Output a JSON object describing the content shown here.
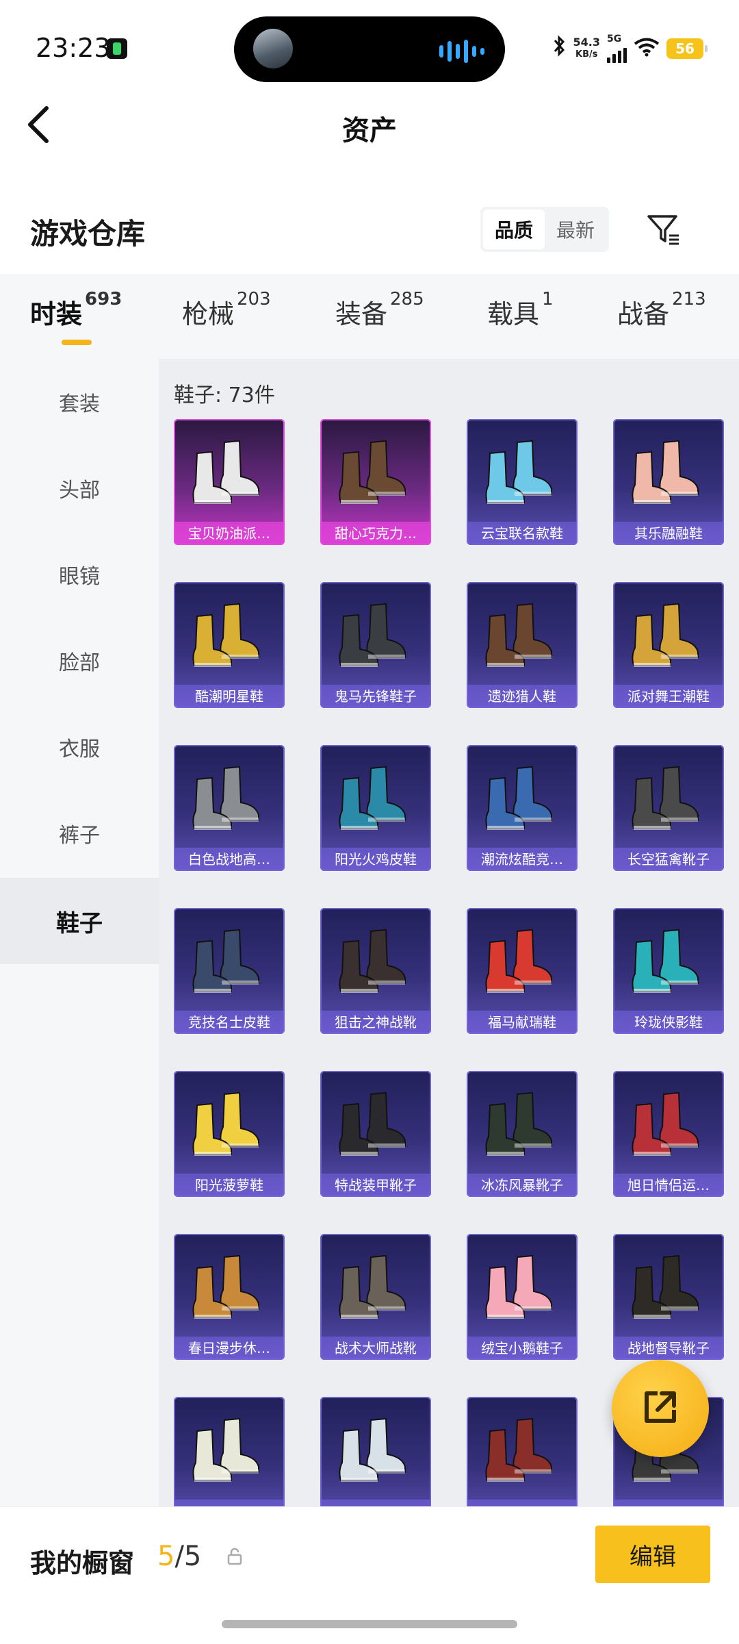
{
  "status_bar": {
    "time": "23:23",
    "net_speed_value": "54.3",
    "net_speed_unit": "KB/s",
    "network_type": "5G",
    "battery": "56"
  },
  "header": {
    "title": "资产"
  },
  "section": {
    "title": "游戏仓库",
    "sort_options": [
      "品质",
      "最新"
    ],
    "sort_selected": "品质"
  },
  "categories": [
    {
      "label": "时装",
      "count": "693",
      "active": true
    },
    {
      "label": "枪械",
      "count": "203"
    },
    {
      "label": "装备",
      "count": "285"
    },
    {
      "label": "载具",
      "count": "1"
    },
    {
      "label": "战备",
      "count": "213"
    }
  ],
  "sidebar": {
    "items": [
      "套装",
      "头部",
      "眼镜",
      "脸部",
      "衣服",
      "裤子",
      "鞋子"
    ],
    "active": "鞋子"
  },
  "grid": {
    "label": "鞋子: 73件",
    "items": [
      {
        "name": "宝贝奶油派…",
        "rarity": "legendary",
        "color": "#e8e8e8"
      },
      {
        "name": "甜心巧克力…",
        "rarity": "legendary",
        "color": "#6b4a34"
      },
      {
        "name": "云宝联名款鞋",
        "rarity": "epic",
        "color": "#6ec8e8"
      },
      {
        "name": "其乐融融鞋",
        "rarity": "epic",
        "color": "#f0b8a8"
      },
      {
        "name": "酷潮明星鞋",
        "rarity": "epic",
        "color": "#d9b034"
      },
      {
        "name": "鬼马先锋鞋子",
        "rarity": "epic",
        "color": "#3a3d42"
      },
      {
        "name": "遗迹猎人鞋",
        "rarity": "epic",
        "color": "#6a4530"
      },
      {
        "name": "派对舞王潮鞋",
        "rarity": "epic",
        "color": "#d4a33a"
      },
      {
        "name": "白色战地高…",
        "rarity": "epic",
        "color": "#8a8d92"
      },
      {
        "name": "阳光火鸡皮鞋",
        "rarity": "epic",
        "color": "#2a8aa8"
      },
      {
        "name": "潮流炫酷竞…",
        "rarity": "epic",
        "color": "#3a6ab0"
      },
      {
        "name": "长空猛禽靴子",
        "rarity": "epic",
        "color": "#4a4a4a"
      },
      {
        "name": "竞技名士皮鞋",
        "rarity": "epic",
        "color": "#3a4a6a"
      },
      {
        "name": "狙击之神战靴",
        "rarity": "epic",
        "color": "#3a3030"
      },
      {
        "name": "福马献瑞鞋",
        "rarity": "epic",
        "color": "#d83a30"
      },
      {
        "name": "玲珑侠影鞋",
        "rarity": "epic",
        "color": "#2ab0b8"
      },
      {
        "name": "阳光菠萝鞋",
        "rarity": "epic",
        "color": "#f0d040"
      },
      {
        "name": "特战装甲靴子",
        "rarity": "epic",
        "color": "#2a2a2e"
      },
      {
        "name": "冰冻风暴靴子",
        "rarity": "epic",
        "color": "#2e3a30"
      },
      {
        "name": "旭日情侣运…",
        "rarity": "epic",
        "color": "#b83038"
      },
      {
        "name": "春日漫步休…",
        "rarity": "epic",
        "color": "#c88a3a"
      },
      {
        "name": "战术大师战靴",
        "rarity": "epic",
        "color": "#6a6258"
      },
      {
        "name": "绒宝小鹅鞋子",
        "rarity": "epic",
        "color": "#f4a8b8"
      },
      {
        "name": "战地督导靴子",
        "rarity": "epic",
        "color": "#2e2a26"
      },
      {
        "name": "",
        "rarity": "epic",
        "color": "#e8e8d8"
      },
      {
        "name": "",
        "rarity": "epic",
        "color": "#d8e0e8"
      },
      {
        "name": "",
        "rarity": "epic",
        "color": "#8a2e2a"
      },
      {
        "name": "",
        "rarity": "epic",
        "color": "#3a3a3a"
      }
    ]
  },
  "bottom": {
    "label": "我的橱窗",
    "count_current": "5",
    "count_total": "/5",
    "edit_label": "编辑"
  }
}
